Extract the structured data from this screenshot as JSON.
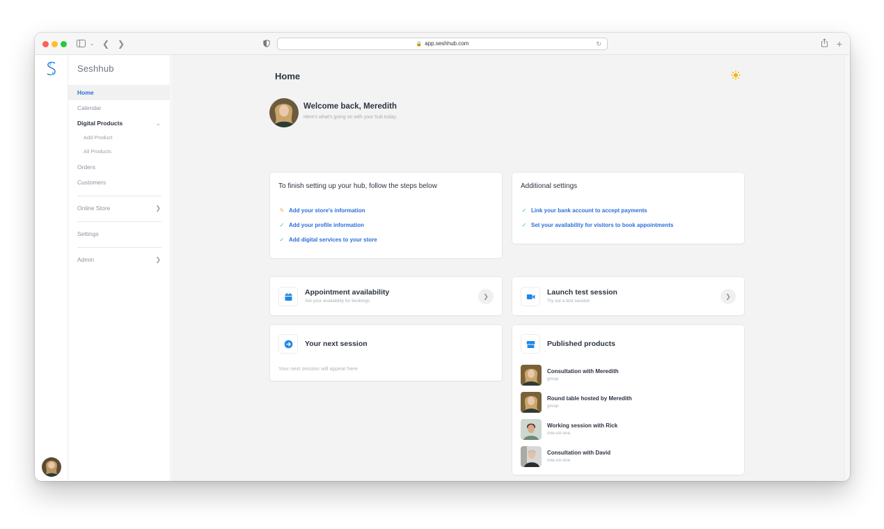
{
  "browser": {
    "url": "app.seshhub.com"
  },
  "app": {
    "brand": "Seshhub"
  },
  "sidebar": {
    "items": [
      {
        "label": "Home"
      },
      {
        "label": "Calendar"
      },
      {
        "label": "Digital Products"
      },
      {
        "label": "Add Product"
      },
      {
        "label": "All Products"
      },
      {
        "label": "Orders"
      },
      {
        "label": "Customers"
      },
      {
        "label": "Online Store"
      },
      {
        "label": "Settings"
      },
      {
        "label": "Admin"
      }
    ]
  },
  "header": {
    "title": "Home"
  },
  "welcome": {
    "title": "Welcome back, Meredith",
    "subtitle": "Here's what's going on with your hub today."
  },
  "setup": {
    "heading": "To finish setting up your hub, follow the steps below",
    "steps": [
      {
        "label": "Add your store's information",
        "state": "pending"
      },
      {
        "label": "Add your profile information",
        "state": "done"
      },
      {
        "label": "Add digital services to your store",
        "state": "done"
      }
    ]
  },
  "additional": {
    "heading": "Additional settings",
    "steps": [
      {
        "label": "Link your bank account to accept payments",
        "state": "done"
      },
      {
        "label": "Set your availability for visitors to book appointments",
        "state": "done"
      }
    ]
  },
  "tiles": {
    "availability": {
      "title": "Appointment availability",
      "subtitle": "Set your availability for bookings"
    },
    "launch": {
      "title": "Launch test session",
      "subtitle": "Try out a test session"
    },
    "next_session": {
      "title": "Your next session",
      "empty": "Your next session will appear here"
    },
    "published": {
      "title": "Published products"
    }
  },
  "products": [
    {
      "name": "Consultation with Meredith",
      "type": "group"
    },
    {
      "name": "Round table hosted by Meredith",
      "type": "group"
    },
    {
      "name": "Working session with Rick",
      "type": "one-on-one"
    },
    {
      "name": "Consultation with David",
      "type": "one-on-one"
    }
  ],
  "colors": {
    "accent": "#2a6fdb",
    "success": "#2cc67a",
    "warning": "#f5a623",
    "icon_blue": "#1e88e5"
  }
}
